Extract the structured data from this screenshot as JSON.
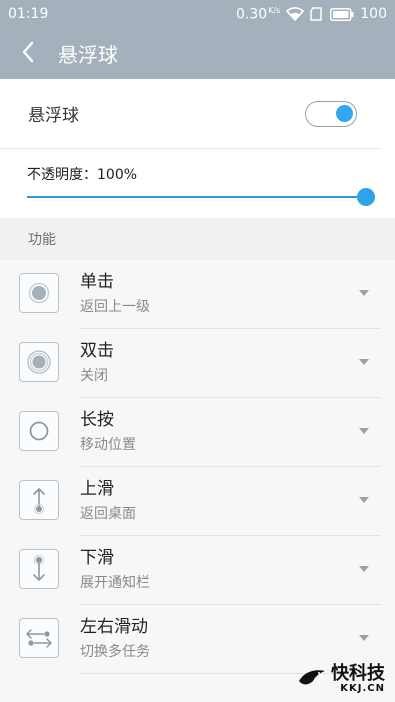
{
  "status_bar": {
    "time": "01:19",
    "net_speed": "0.30",
    "net_unit": "K/s",
    "battery": "100",
    "icons": [
      "wifi-icon",
      "sim-icon",
      "battery-icon"
    ]
  },
  "header": {
    "title": "悬浮球",
    "back_icon": "back-arrow-icon",
    "bg_color": "#a4b1bc"
  },
  "toggle_row": {
    "label": "悬浮球",
    "enabled": true,
    "accent_color": "#32a6ee"
  },
  "opacity": {
    "label": "不透明度：100%",
    "value_percent": 100
  },
  "section": {
    "title": "功能"
  },
  "functions": [
    {
      "title": "单击",
      "subtitle": "返回上一级",
      "icon": "single-tap-icon"
    },
    {
      "title": "双击",
      "subtitle": "关闭",
      "icon": "double-tap-icon"
    },
    {
      "title": "长按",
      "subtitle": "移动位置",
      "icon": "long-press-icon"
    },
    {
      "title": "上滑",
      "subtitle": "返回桌面",
      "icon": "swipe-up-icon"
    },
    {
      "title": "下滑",
      "subtitle": "展开通知栏",
      "icon": "swipe-down-icon"
    },
    {
      "title": "左右滑动",
      "subtitle": "切换多任务",
      "icon": "swipe-horizontal-icon"
    }
  ],
  "watermark": {
    "main": "快科技",
    "sub": "KKJ.CN"
  }
}
